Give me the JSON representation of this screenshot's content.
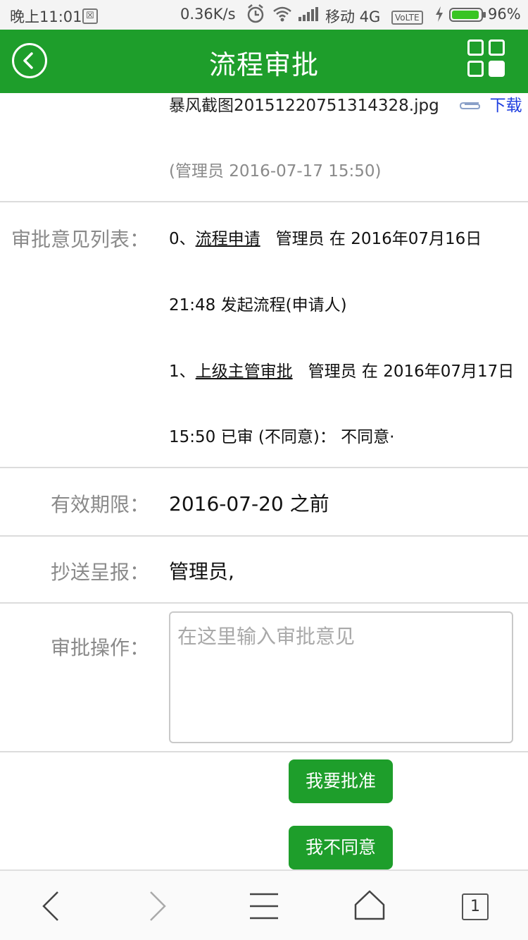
{
  "status_bar": {
    "time": "晚上11:01",
    "speed": "0.36K/s",
    "carrier": "移动 4G",
    "volte": "VoLTE",
    "battery": "96%",
    "battery_level": 0.96
  },
  "header": {
    "title": "流程审批"
  },
  "attachment": {
    "filename": "暴风截图20151220751314328.jpg",
    "download_label": "下载",
    "meta": "(管理员 2016-07-17 15:50)"
  },
  "opinions": {
    "label": "审批意见列表：",
    "items": [
      {
        "prefix": "0、",
        "step": "流程申请",
        "line1_rest": "管理员 在 2016年07月16日",
        "line2": "21:48 发起流程(申请人)"
      },
      {
        "prefix": "1、",
        "step": "上级主管审批",
        "line1_rest": "管理员 在 2016年07月17日",
        "line2": "15:50 已审 (不同意)： 不同意·"
      }
    ]
  },
  "validity": {
    "label": "有效期限：",
    "value": "2016-07-20 之前"
  },
  "cc": {
    "label": "抄送呈报：",
    "value": "管理员,"
  },
  "operation": {
    "label": "审批操作：",
    "placeholder": "在这里输入审批意见"
  },
  "buttons": {
    "approve": "我要批准",
    "disagree": "我不同意"
  },
  "bottom_bar": {
    "tab_count": "1"
  },
  "colors": {
    "brand_green": "#1e9e2b",
    "link_blue": "#1f3fe0"
  }
}
